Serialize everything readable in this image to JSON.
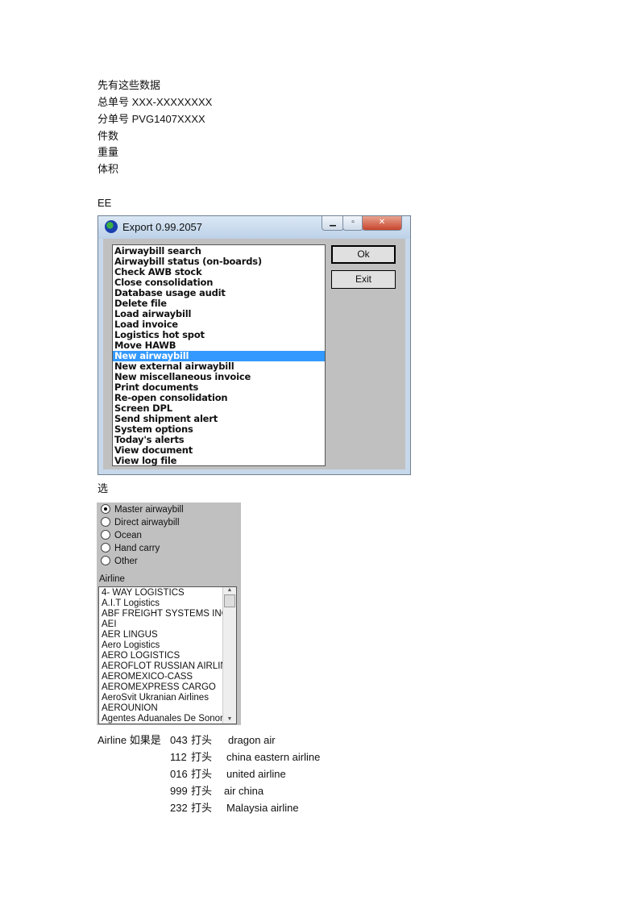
{
  "intro": {
    "lines": [
      "先有这些数据",
      "总单号 XXX-XXXXXXXX",
      "分单号 PVG1407XXXX",
      "件数",
      "重量",
      "体积"
    ]
  },
  "ee_label": "EE",
  "dialog": {
    "title": "Export 0.99.2057",
    "ok": "Ok",
    "exit": "Exit",
    "selected_index": 10,
    "items": [
      "Airwaybill search",
      "Airwaybill status (on-boards)",
      "Check AWB stock",
      "Close consolidation",
      "Database usage audit",
      "Delete file",
      "Load airwaybill",
      "Load invoice",
      "Logistics hot spot",
      "Move HAWB",
      "New airwaybill",
      "New external airwaybill",
      "New miscellaneous invoice",
      "Print documents",
      "Re-open consolidation",
      "Screen DPL",
      "Send shipment alert",
      "System options",
      "Today's alerts",
      "View document",
      "View log file"
    ]
  },
  "select_label": "选",
  "panel": {
    "radios": [
      "Master airwaybill",
      "Direct airwaybill",
      "Ocean",
      "Hand carry",
      "Other"
    ],
    "selected_radio": 0,
    "airline_label": "Airline",
    "airlines": [
      "4- WAY LOGISTICS",
      "A.I.T Logistics",
      "ABF FREIGHT SYSTEMS INC.",
      "AEI",
      "AER LINGUS",
      "Aero Logistics",
      "AERO LOGISTICS",
      "AEROFLOT RUSSIAN AIRLINI",
      "AEROMEXICO-CASS",
      "AEROMEXPRESS CARGO",
      "AeroSvit Ukranian Airlines",
      "AEROUNION",
      "Agentes Aduanales De Sonora"
    ]
  },
  "notes": {
    "prefix": "Airline  如果是",
    "rows": [
      {
        "code": "043",
        "word": "打头",
        "name": "dragon air"
      },
      {
        "code": "112",
        "word": "打头",
        "name": "china eastern airline"
      },
      {
        "code": "016",
        "word": "打头",
        "name": "united airline"
      },
      {
        "code": "999",
        "word": "打头",
        "name": "air china"
      },
      {
        "code": "232",
        "word": "打头",
        "name": "Malaysia airline"
      }
    ]
  }
}
